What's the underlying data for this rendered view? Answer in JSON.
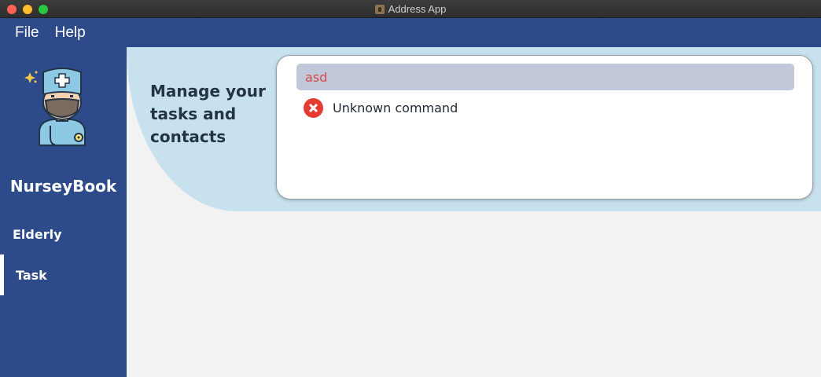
{
  "window": {
    "title": "Address App"
  },
  "menubar": {
    "items": [
      "File",
      "Help"
    ]
  },
  "sidebar": {
    "brand": "NurseyBook",
    "avatar_icon": "nurse-avatar-icon",
    "items": [
      {
        "label": "Elderly",
        "selected": false
      },
      {
        "label": "Task",
        "selected": true
      }
    ]
  },
  "header": {
    "tagline": "Manage your tasks and contacts"
  },
  "command": {
    "input_value": "asd",
    "result_icon": "error-icon",
    "result_text": "Unknown command"
  },
  "colors": {
    "primary": "#2d4a8a",
    "header_band": "#c7e2ee",
    "input_bg": "#c2c8da",
    "error": "#e53b30",
    "input_text": "#d44a4a"
  }
}
